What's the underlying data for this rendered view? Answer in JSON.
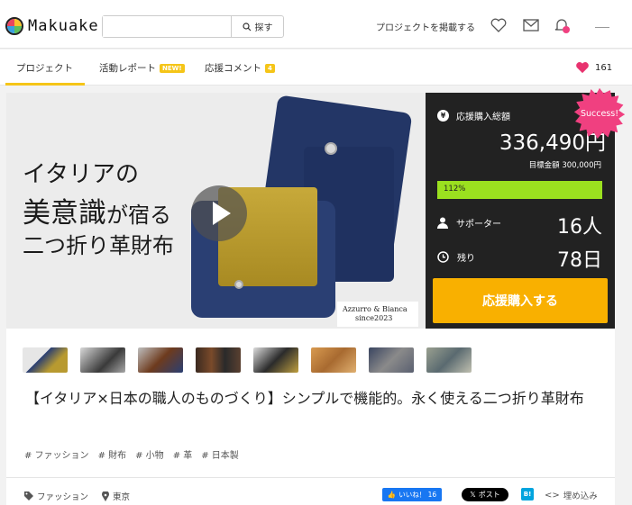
{
  "app": {
    "logo_text": "Makuake"
  },
  "header": {
    "search_placeholder": "",
    "search_button": "探す",
    "post_project": "プロジェクトを掲載する",
    "icons": [
      "heart-icon",
      "mail-icon",
      "bell-icon"
    ]
  },
  "tabs": [
    {
      "label": "プロジェクト",
      "active": true
    },
    {
      "label": "活動レポート",
      "badge": "NEW!"
    },
    {
      "label": "応援コメント",
      "badge": "4"
    }
  ],
  "likes_count": "161",
  "hero": {
    "line1": "イタリアの",
    "line2_a": "美意識",
    "line2_b": "が宿る",
    "line3": "二つ折り革財布",
    "brand_line1": "Azzurro & Bianca",
    "brand_line2": "since2023"
  },
  "panel": {
    "total_label": "応援購入総額",
    "amount": "336,490円",
    "goal": "目標金額 300,000円",
    "progress_text": "112%",
    "progress_percent": 112,
    "supporters_label": "サポーター",
    "supporters_value": "16人",
    "remaining_label": "残り",
    "remaining_value": "78日",
    "cta": "応援購入する",
    "success_badge": "Success!"
  },
  "project_title": "【イタリア×日本の職人のものづくり】シンプルで機能的。永く使える二つ折り革財布",
  "tags": [
    "# ファッション",
    "# 財布",
    "# 小物",
    "# 革",
    "# 日本製"
  ],
  "meta": {
    "category": "ファッション",
    "location": "東京"
  },
  "share": {
    "facebook": "いいね！ 16",
    "x_post": "ポスト",
    "hatena": "B!",
    "embed": "埋め込み"
  },
  "colors": {
    "accent_yellow": "#f5c518",
    "cta": "#f9b000",
    "progress": "#9be01f",
    "success": "#f04080",
    "heart": "#e8336f"
  }
}
